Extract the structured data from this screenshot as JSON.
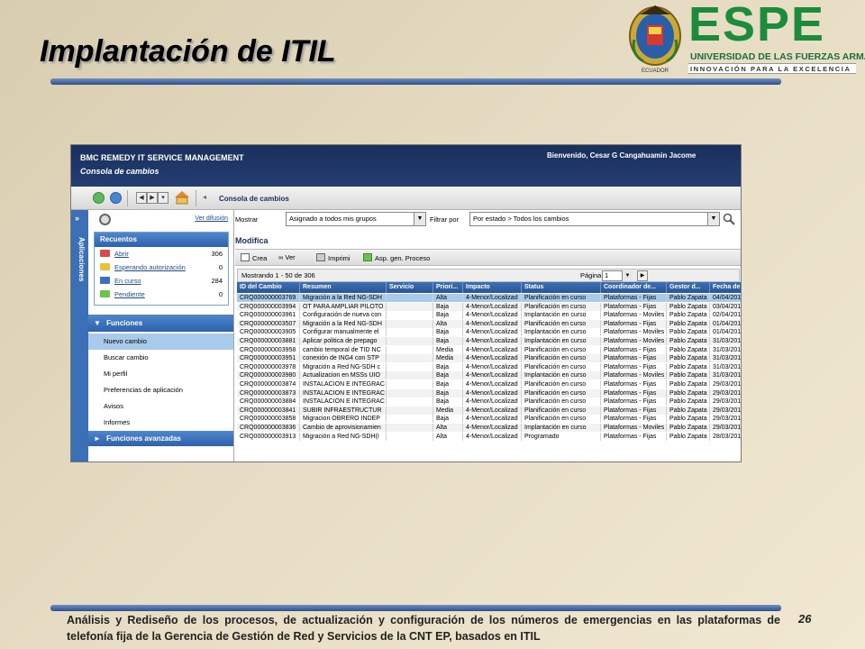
{
  "slide": {
    "title": "Implantación de ITIL",
    "footer": "Análisis y Rediseño de los procesos, de actualización y configuración de los números de emergencias en las plataformas de telefonía fija de la Gerencia de Gestión de Red y Servicios de la CNT EP, basados en ITIL",
    "page_number": "26"
  },
  "logo": {
    "name": "ESPE",
    "university": "UNIVERSIDAD DE LAS FUERZAS ARMADAS",
    "motto": "INNOVACIÓN PARA LA EXCELENCIA",
    "seal_text": "ECUADOR",
    "brand_color": "#1c8c3c"
  },
  "app": {
    "name": "BMC REMEDY IT SERVICE MANAGEMENT",
    "console": "Consola de cambios",
    "welcome": "Bienvenido, Cesar G Cangahuamin Jacome",
    "breadcrumb": "Consola de cambios"
  },
  "left_strip": {
    "label": "Aplicaciones"
  },
  "sidebar": {
    "ver_difusion": "Ver difusión",
    "recuentos_title": "Recuentos",
    "recuentos": [
      {
        "label": "Abrir",
        "count": "306",
        "color": "#d94a4a"
      },
      {
        "label": "Esperando autorización",
        "count": "0",
        "color": "#e8c23a"
      },
      {
        "label": "En curso",
        "count": "284",
        "color": "#3d6fc1"
      },
      {
        "label": "Pendiente",
        "count": "0",
        "color": "#6cc24a"
      }
    ],
    "funciones_title": "Funciones",
    "funciones": [
      "Nuevo cambio",
      "Buscar cambio",
      "Mi perfil",
      "Preferencias de aplicación",
      "Avisos",
      "Informes"
    ],
    "funciones_avanzadas": "Funciones avanzadas"
  },
  "filters": {
    "mostrar_label": "Mostrar",
    "mostrar_value": "Asignado a todos mis grupos",
    "filtrar_label": "Filtrar por",
    "filtrar_value": "Por estado > Todos los cambios"
  },
  "modifica": "Modifica",
  "actions": [
    "Crea",
    "Ver",
    "Imprimi",
    "Asp. gen. Proceso"
  ],
  "pager": {
    "showing": "Mostrando 1 - 50 de 306",
    "page_label": "Página",
    "page_value": "1"
  },
  "table": {
    "columns": [
      "ID del Cambio",
      "Resumen",
      "Servicio",
      "Priori...",
      "Impacto",
      "Status",
      "Coordinador de...",
      "Gestor d...",
      "Fecha de"
    ],
    "rows": [
      [
        "CRQ000000003769",
        "Migración a la Red NG-SDH",
        "",
        "Alta",
        "4-Menor/Localizad",
        "Planificación en curso",
        "Plataformas - Fijas",
        "Pablo Zapata",
        "04/04/201"
      ],
      [
        "CRQ000000003994",
        "OT PARA AMPLIAR PILOTO",
        "",
        "Baja",
        "4-Menor/Localizad",
        "Planificación en curso",
        "Plataformas - Fijas",
        "Pablo Zapata",
        "03/04/201"
      ],
      [
        "CRQ000000003961",
        "Configuración de nueva con",
        "",
        "Baja",
        "4-Menor/Localizad",
        "Implantación en curso",
        "Plataformas - Moviles",
        "Pablo Zapata",
        "02/04/201"
      ],
      [
        "CRQ000000003507",
        "Migración a la Red NG-SDH",
        "",
        "Alta",
        "4-Menor/Localizad",
        "Planificación en curso",
        "Plataformas - Fijas",
        "Pablo Zapata",
        "01/04/201"
      ],
      [
        "CRQ000000003905",
        "Configurar manualmente el",
        "",
        "Baja",
        "4-Menor/Localizad",
        "Implantación en curso",
        "Plataformas - Moviles",
        "Pablo Zapata",
        "01/04/201"
      ],
      [
        "CRQ000000003881",
        "Aplicar politica de prepago",
        "",
        "Baja",
        "4-Menor/Localizad",
        "Implantación en curso",
        "Plataformas - Moviles",
        "Pablo Zapata",
        "31/03/201"
      ],
      [
        "CRQ000000003958",
        "cambio temporal de TID NC",
        "",
        "Media",
        "4-Menor/Localizad",
        "Planificación en curso",
        "Plataformas - Fijas",
        "Pablo Zapata",
        "31/03/201"
      ],
      [
        "CRQ000000003951",
        "conexión de ING4 con STP",
        "",
        "Media",
        "4-Menor/Localizad",
        "Planificación en curso",
        "Plataformas - Fijas",
        "Pablo Zapata",
        "31/03/201"
      ],
      [
        "CRQ000000003978",
        "Migración a Red NG-SDH c",
        "",
        "Baja",
        "4-Menor/Localizad",
        "Planificación en curso",
        "Plataformas - Fijas",
        "Pablo Zapata",
        "31/03/201"
      ],
      [
        "CRQ000000003980",
        "Actualizacion en MSSs UIO",
        "",
        "Baja",
        "4-Menor/Localizad",
        "Implantación en curso",
        "Plataformas - Moviles",
        "Pablo Zapata",
        "31/03/201"
      ],
      [
        "CRQ000000003874",
        "INSTALACION E INTEGRAC",
        "",
        "Baja",
        "4-Menor/Localizad",
        "Planificación en curso",
        "Plataformas - Fijas",
        "Pablo Zapata",
        "29/03/201"
      ],
      [
        "CRQ000000003873",
        "INSTALACION E INTEGRAC",
        "",
        "Baja",
        "4-Menor/Localizad",
        "Planificación en curso",
        "Plataformas - Fijas",
        "Pablo Zapata",
        "29/03/201"
      ],
      [
        "CRQ000000003884",
        "INSTALACION E INTEGRAC",
        "",
        "Baja",
        "4-Menor/Localizad",
        "Planificación en curso",
        "Plataformas - Fijas",
        "Pablo Zapata",
        "29/03/201"
      ],
      [
        "CRQ000000003841",
        "SUBIR INFRAESTRUCTUR",
        "",
        "Media",
        "4-Menor/Localizad",
        "Planificación en curso",
        "Plataformas - Fijas",
        "Pablo Zapata",
        "29/03/201"
      ],
      [
        "CRQ000000003858",
        "Migracion OBRERO INDEP",
        "",
        "Baja",
        "4-Menor/Localizad",
        "Planificación en curso",
        "Plataformas - Fijas",
        "Pablo Zapata",
        "29/03/201"
      ],
      [
        "CRQ000000003836",
        "Cambio de aprovisionamien",
        "",
        "Alta",
        "4-Menor/Localizad",
        "Implantación en curso",
        "Plataformas - Moviles",
        "Pablo Zapata",
        "29/03/201"
      ],
      [
        "CRQ000000003913",
        "Migración a Red NG-SDH(I",
        "",
        "Alta",
        "4-Menor/Localizad",
        "Programado",
        "Plataformas - Fijas",
        "Pablo Zapata",
        "28/03/201"
      ]
    ]
  }
}
